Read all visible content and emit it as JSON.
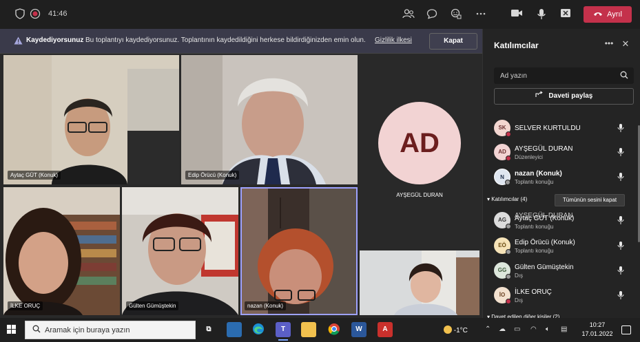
{
  "topbar": {
    "timer": "41:46",
    "leave_label": "Ayrıl",
    "icons": [
      "shield-icon",
      "record-icon",
      "participants-icon",
      "chat-icon",
      "reactions-icon",
      "more-icon",
      "camera-icon",
      "mic-icon",
      "share-icon",
      "phone-icon"
    ]
  },
  "banner": {
    "title": "Kaydediyorsunuz",
    "message": "Bu toplantıyı kaydediyorsunuz. Toplantının kaydedildiğini herkese bildirdiğinizden emin olun.",
    "link": "Gizlilik ilkesi",
    "close_label": "Kapat"
  },
  "videos": {
    "tile1": "Aytaç GÜT (Konuk)",
    "tile2": "Edip Örücü (Konuk)",
    "tile3_initials": "AD",
    "tile3_name": "AYŞEGÜL DURAN",
    "tile4": "İLKE ORUÇ",
    "tile5": "Gülten Gümüştekin",
    "tile6": "nazan (Konuk)"
  },
  "panel": {
    "title": "Katılımcılar",
    "search_placeholder": "Ad yazın",
    "share_label": "Daveti paylaş",
    "section_attendees": "Katılımcılar (4)",
    "mute_all": "Tümünün sesini kapat",
    "section_invited": "Davet edilen diğer kişiler (2)",
    "presenters": [
      {
        "initials": "SK",
        "name": "SELVER KURTULDU",
        "role": "",
        "color": "#f3d6d0"
      },
      {
        "initials": "AD",
        "name": "AYŞEGÜL DURAN",
        "role": "Düzenleyici",
        "color": "#f2d3d3"
      },
      {
        "initials": "N",
        "name": "nazan (Konuk)",
        "role": "Toplantı konuğu",
        "color": "#dfe6f0"
      }
    ],
    "attendees": [
      {
        "initials": "AG",
        "name": "Aytaç GÜT (Konuk)",
        "overlap_name": "AYŞEGÜL DURAN",
        "role": "Toplantı konuğu",
        "color": "#dcdcdc"
      },
      {
        "initials": "EÖ",
        "name": "Edip Örücü (Konuk)",
        "role": "Toplantı konuğu",
        "color": "#f6e3b8"
      },
      {
        "initials": "GG",
        "name": "Gülten Gümüştekin",
        "role": "Dış",
        "color": "#dde7dc"
      },
      {
        "initials": "İO",
        "name": "İLKE ORUÇ",
        "role": "Dış",
        "color": "#f3e1cf"
      }
    ]
  },
  "taskbar": {
    "search_text": "Aramak için buraya yazın",
    "weather": "-1°C",
    "time": "10:27",
    "date": "17.01.2022"
  }
}
